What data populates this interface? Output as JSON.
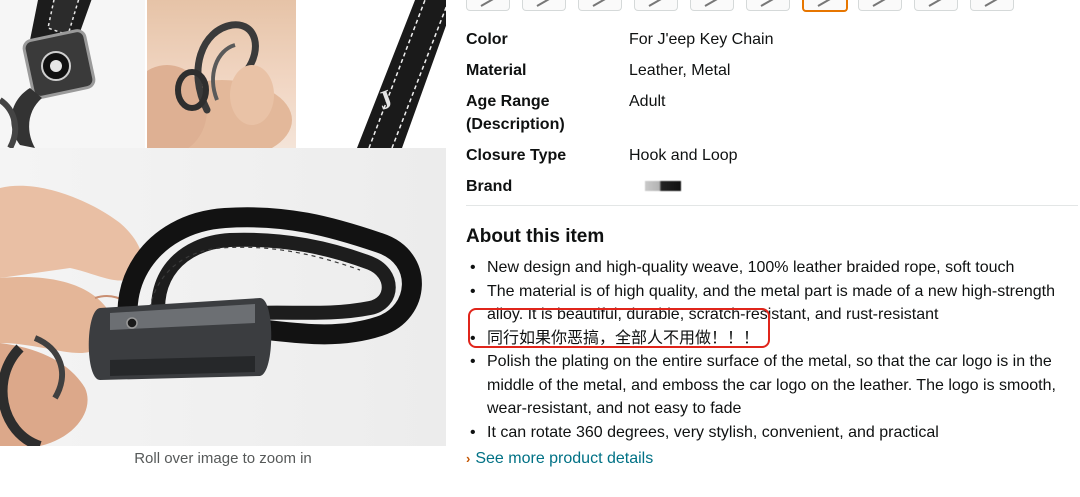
{
  "gallery": {
    "zoom_hint": "Roll over image to zoom in",
    "share_icon": "share-icon"
  },
  "swatches": {
    "count": 10,
    "selected_index": 6
  },
  "specs": [
    {
      "label": "Color",
      "value": "For J'eep Key Chain"
    },
    {
      "label": "Material",
      "value": "Leather, Metal"
    },
    {
      "label": "Age Range (Description)",
      "value": "Adult"
    },
    {
      "label": "Closure Type",
      "value": "Hook and Loop"
    },
    {
      "label": "Brand",
      "value": ""
    }
  ],
  "about": {
    "heading": "About this item",
    "bullets": [
      "New design and high-quality weave, 100% leather braided rope, soft touch",
      "The material is of high quality, and the metal part is made of a new high-strength alloy. It is beautiful, durable, scratch-resistant, and rust-resistant",
      "同行如果你恶搞，全部人不用做！！！",
      "Polish the plating on the entire surface of the metal, so that the car logo is in the middle of the metal, and emboss the car logo on the leather. The logo is smooth, wear-resistant, and not easy to fade",
      "It can rotate 360 degrees, very stylish, convenient, and practical"
    ]
  },
  "see_more": "See more product details",
  "colors": {
    "highlight": "#e0251b",
    "link": "#007185",
    "selected_swatch": "#e77600"
  }
}
